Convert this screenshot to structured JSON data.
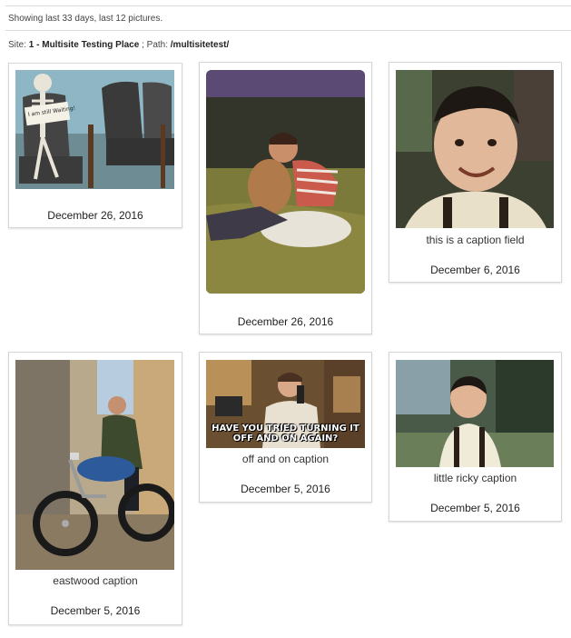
{
  "header": {
    "summary": "Showing last 33 days, last 12 pictures.",
    "site_label": "Site:",
    "site_name": "1 - Multisite Testing Place",
    "path_label": "; Path:",
    "path_value": "/multisitetest/"
  },
  "pictures": [
    {
      "caption": "",
      "date": "December 26, 2016",
      "image": "skeleton-waiting-photo",
      "sign_text": "I am still Waiting!"
    },
    {
      "caption": "",
      "date": "December 26, 2016",
      "image": "boy-with-dog-photo"
    },
    {
      "caption": "this is a caption field",
      "date": "December 6, 2016",
      "image": "smiling-boy-portrait-photo"
    },
    {
      "caption": "eastwood caption",
      "date": "December 5, 2016",
      "image": "man-on-motorcycle-photo"
    },
    {
      "caption": "off and on caption",
      "date": "December 5, 2016",
      "image": "it-crowd-meme-photo",
      "meme_text": "HAVE YOU TRIED TURNING IT OFF AND ON AGAIN?"
    },
    {
      "caption": "little ricky caption",
      "date": "December 5, 2016",
      "image": "little-boy-suspenders-photo"
    }
  ]
}
